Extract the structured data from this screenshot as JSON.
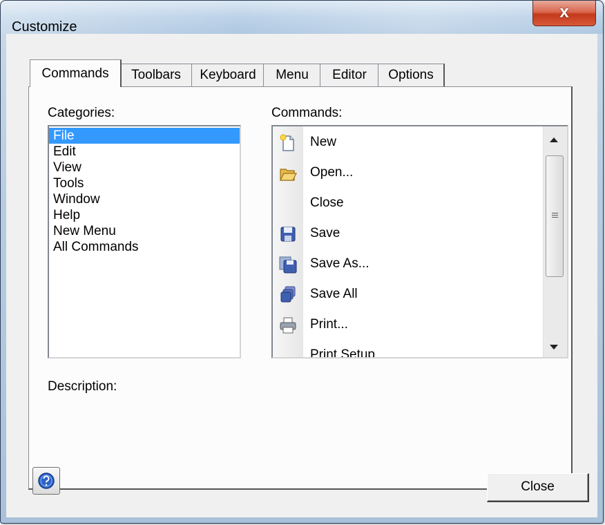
{
  "window": {
    "title": "Customize",
    "close_glyph": "x"
  },
  "tabs": [
    {
      "label": "Commands",
      "active": true
    },
    {
      "label": "Toolbars"
    },
    {
      "label": "Keyboard"
    },
    {
      "label": "Menu"
    },
    {
      "label": "Editor"
    },
    {
      "label": "Options"
    }
  ],
  "categories": {
    "label": "Categories:",
    "items": [
      "File",
      "Edit",
      "View",
      "Tools",
      "Window",
      "Help",
      "New Menu",
      "All Commands"
    ],
    "selected": "File"
  },
  "commands": {
    "label": "Commands:",
    "items": [
      {
        "label": "New",
        "icon": "new-document-icon"
      },
      {
        "label": "Open...",
        "icon": "open-folder-icon"
      },
      {
        "label": "Close",
        "icon": ""
      },
      {
        "label": "Save",
        "icon": "save-disk-icon"
      },
      {
        "label": "Save As...",
        "icon": "save-as-icon"
      },
      {
        "label": "Save All",
        "icon": "save-all-icon"
      },
      {
        "label": "Print...",
        "icon": "printer-icon"
      },
      {
        "label": "Print Setup",
        "icon": ""
      }
    ]
  },
  "description": {
    "label": "Description:"
  },
  "footer": {
    "close_label": "Close",
    "help_icon": "help-icon"
  },
  "colors": {
    "selection": "#3399ff",
    "close_button_red": "#c4391c"
  }
}
